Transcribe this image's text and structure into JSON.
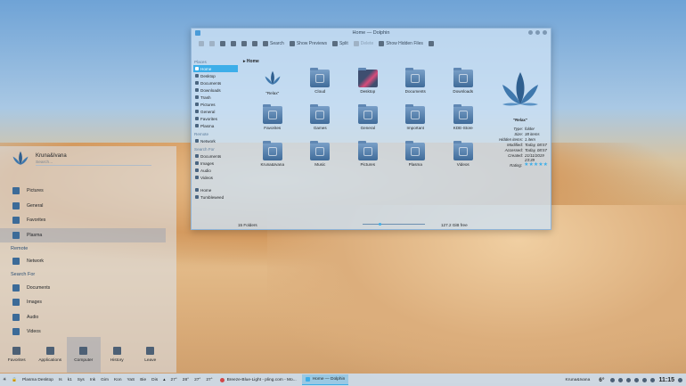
{
  "window": {
    "title": "Home — Dolphin"
  },
  "toolbar": {
    "search": "Search",
    "show_previews": "Show Previews",
    "split": "Split",
    "delete": "Delete",
    "show_hidden": "Show Hidden Files"
  },
  "sidebar": {
    "places_label": "Places",
    "places": [
      "Home",
      "Desktop",
      "Documents",
      "Downloads",
      "Trash",
      "Pictures",
      "General",
      "Favorites",
      "Plasma"
    ],
    "remote_label": "Remote",
    "remote": [
      "Network"
    ],
    "search_label": "Search For",
    "search": [
      "Documents",
      "Images",
      "Audio",
      "Videos"
    ],
    "devices": [
      "Home",
      "Tumbleweed"
    ]
  },
  "breadcrumb": "Home",
  "folders": [
    "\"Relax\"",
    "Cloud",
    "Desktop",
    "Documents",
    "Downloads",
    "Favorites",
    "Games",
    "General",
    "Important",
    "KDE-Store",
    "Kruna&Ivana",
    "Music",
    "Pictures",
    "Plasma",
    "Videos"
  ],
  "info": {
    "name": "\"Relax\"",
    "rows": [
      {
        "k": "Type:",
        "v": "folder"
      },
      {
        "k": "Size:",
        "v": "38 items"
      },
      {
        "k": "Hidden items:",
        "v": "1 item"
      },
      {
        "k": "Modified:",
        "v": "Today, 08:57"
      },
      {
        "k": "Accessed:",
        "v": "Today, 08:57"
      },
      {
        "k": "Created:",
        "v": "21/11/2019 23:39"
      },
      {
        "k": "Rating:",
        "v": "★★★★★"
      }
    ]
  },
  "status": {
    "folders": "15 Folders",
    "free": "127.2 GiB free"
  },
  "launcher": {
    "user": "Kruna&Ivana",
    "search_placeholder": "Search...",
    "items": [
      "Pictures",
      "General",
      "Favorites",
      "Plasma"
    ],
    "remote_label": "Remote",
    "remote": [
      "Network"
    ],
    "search_label": "Search For",
    "search": [
      "Documents",
      "Images",
      "Audio",
      "Videos"
    ],
    "footer": [
      "Favorites",
      "Applications",
      "Computer",
      "History",
      "Leave"
    ]
  },
  "panel": {
    "desktop": "Plasma Desktop",
    "pager": [
      "Is",
      "k1",
      "Sys",
      "Ink",
      "Gim",
      "Kon",
      "YaS",
      "Bie",
      "Dis"
    ],
    "temps": [
      "27°",
      "28°",
      "27°",
      "27°"
    ],
    "tasks": [
      "Breeze-Blue-Light - pling.com - Mo...",
      "Home — Dolphin"
    ],
    "user": "Kruna&Ivana",
    "weather": "6°",
    "clock": "11:15"
  },
  "colors": {
    "accent": "#3daee9",
    "folder": "#4f7aa8"
  }
}
